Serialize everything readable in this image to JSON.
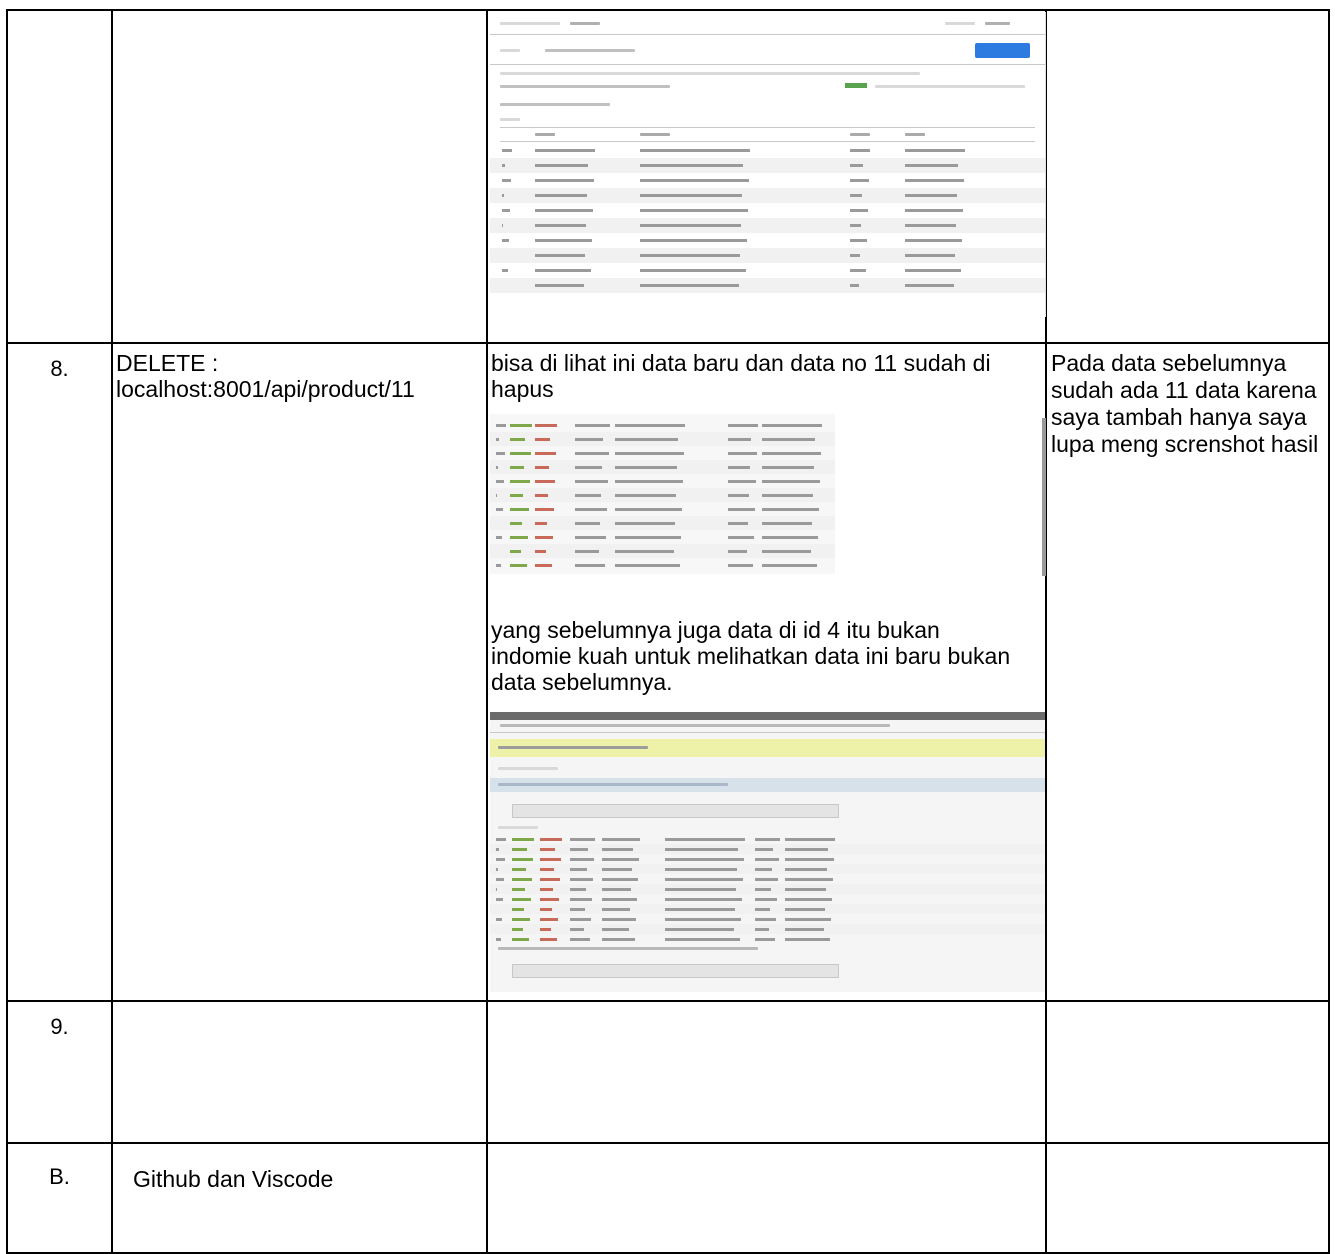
{
  "rows": [
    {
      "no": "",
      "request": "",
      "result_text": "",
      "note": ""
    },
    {
      "no": "8.",
      "request": "DELETE : localhost:8001/api/product/11",
      "result_text": "bisa di lihat ini data baru dan data no 11 sudah di hapus",
      "result_text2": "yang sebelumnya juga data di id 4 itu bukan indomie kuah untuk melihatkan data ini baru bukan data sebelumnya.",
      "note": "Pada data sebelumnya sudah ada 11 data karena saya tambah hanya saya lupa meng screnshot hasil"
    },
    {
      "no": "9.",
      "request": "",
      "result_text": "",
      "note": ""
    },
    {
      "no": "B.",
      "request": "Github dan Viscode",
      "result_text": "",
      "note": ""
    }
  ],
  "colors": {
    "border": "#000000",
    "accent_blue": "#2d7ae0",
    "highlight_yellow": "#eef2a8"
  }
}
